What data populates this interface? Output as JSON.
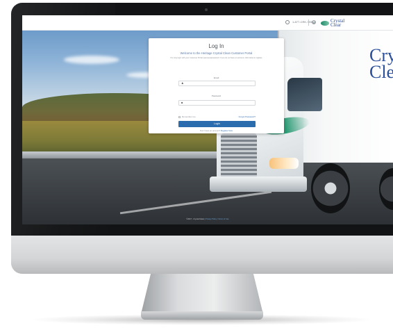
{
  "header": {
    "phone": "1-877-CRK-7938",
    "logo_word_1": "Crystal",
    "logo_word_2": "Clear"
  },
  "login": {
    "title": "Log In",
    "welcome": "Welcome to the Heritage Crystal Clean Customer Portal",
    "description": "You may login with your Customer Portal username/password. If you do not have an account, click below to register.",
    "email_label": "Email",
    "password_label": "Password",
    "remember_label": "Remember me",
    "forgot_label": "Forgot Password?",
    "login_button": "Login",
    "register_prompt": "Don't have an account?",
    "register_link": "Register Now"
  },
  "truck": {
    "brand_line_1": "Crys",
    "brand_line_2": "Clea"
  },
  "footer": {
    "copyright": "©2017 - Crystal Clean |",
    "link": "Privacy Policy | Terms of Use"
  },
  "colors": {
    "accent": "#2b6cae",
    "logo_blue": "#2a4f9a",
    "logo_green": "#1f8a6a"
  }
}
